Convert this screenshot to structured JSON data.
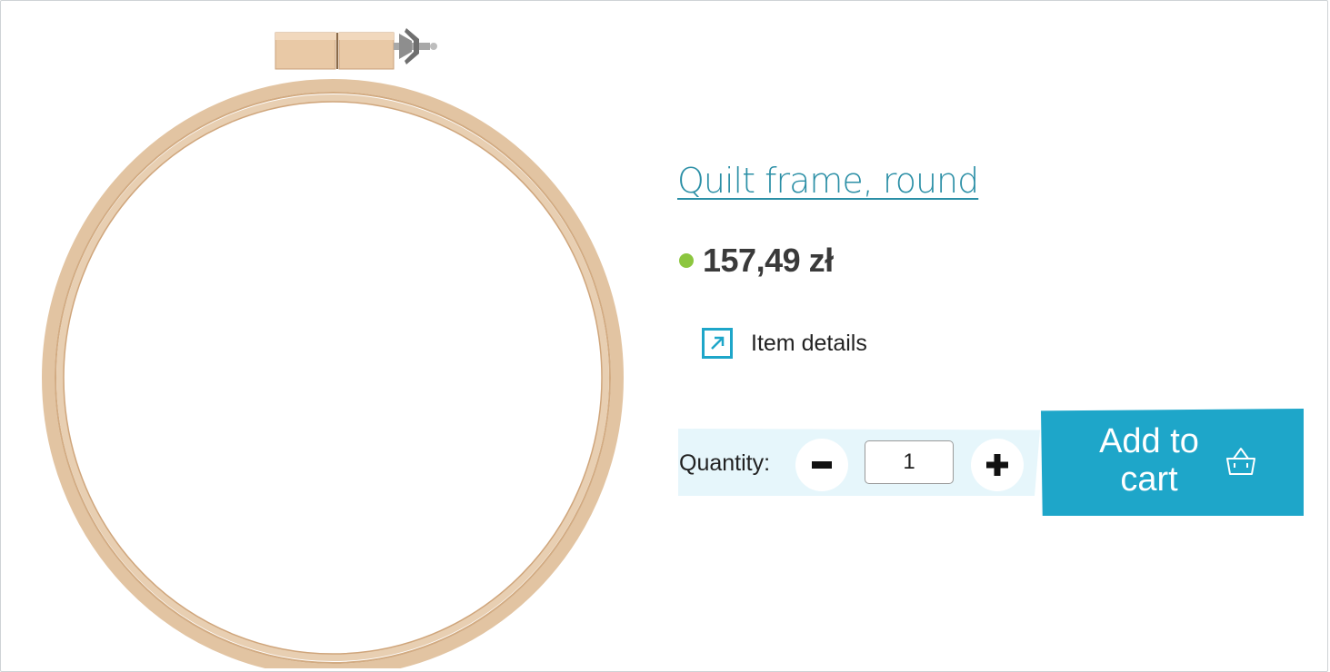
{
  "product": {
    "title": "Quilt frame, round",
    "price": "157,49 zł",
    "stock_color": "#8cc63f",
    "accent_color": "#1ea6c9",
    "details_label": "Item details",
    "details_icon": "external-link-arrow-icon"
  },
  "quantity": {
    "label": "Quantity:",
    "value": "1",
    "decrement_icon": "minus-icon",
    "increment_icon": "plus-icon"
  },
  "cart": {
    "label": "Add to cart",
    "icon": "basket-icon"
  }
}
